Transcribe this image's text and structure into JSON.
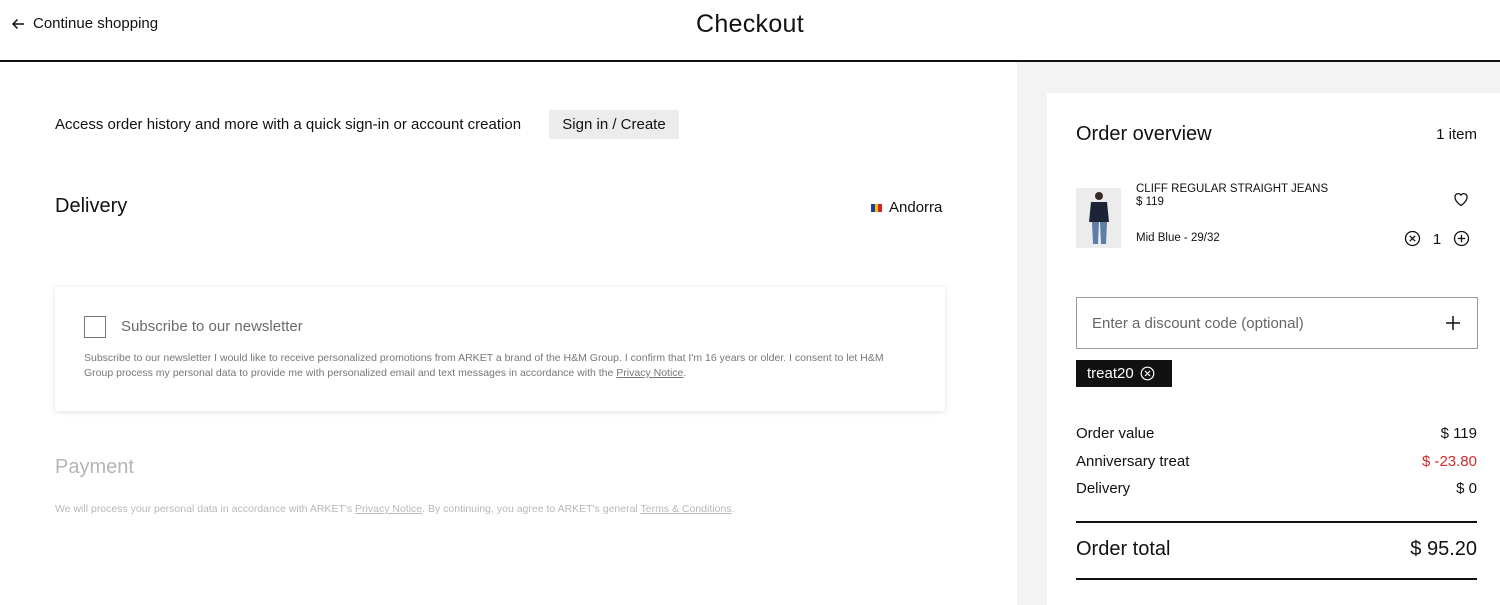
{
  "header": {
    "back_label": "Continue shopping",
    "title": "Checkout"
  },
  "account": {
    "prompt": "Access order history and more with a quick sign-in or account creation",
    "signin_label": "Sign in / Create"
  },
  "delivery": {
    "title": "Delivery",
    "country": "Andorra"
  },
  "newsletter": {
    "label": "Subscribe to our newsletter",
    "checked": false,
    "legal": "Subscribe to our newsletter I would like to receive personalized promotions from ARKET a brand of the H&M Group. I confirm that I'm 16 years or older. I consent to let H&M Group process my personal data to provide me with personalized email and text messages in accordance with the ",
    "legal_link": "Privacy Notice",
    "legal_end": "."
  },
  "payment": {
    "title": "Payment",
    "legal_start": "We will process your personal data in accordance with ARKET's ",
    "privacy_link": "Privacy Notice",
    "legal_mid": ". By continuing, you agree to ARKET's general ",
    "terms_link": "Terms & Conditions",
    "legal_end": "."
  },
  "order": {
    "title": "Order overview",
    "item_count": "1 item",
    "product": {
      "name": "CLIFF REGULAR STRAIGHT JEANS",
      "price": "$ 119",
      "variant": "Mid Blue - 29/32",
      "quantity": "1"
    },
    "discount_placeholder": "Enter a discount code (optional)",
    "applied_code": "treat20",
    "summary": {
      "order_value_label": "Order value",
      "order_value": "$ 119",
      "anniversary_label": "Anniversary treat",
      "anniversary_value": "$ -23.80",
      "delivery_label": "Delivery",
      "delivery_value": "$ 0",
      "total_label": "Order total",
      "total_value": "$ 95.20"
    }
  },
  "colors": {
    "accent": "#111111",
    "discount_red": "#d32a2a",
    "panel_bg": "#f3f3f3"
  }
}
